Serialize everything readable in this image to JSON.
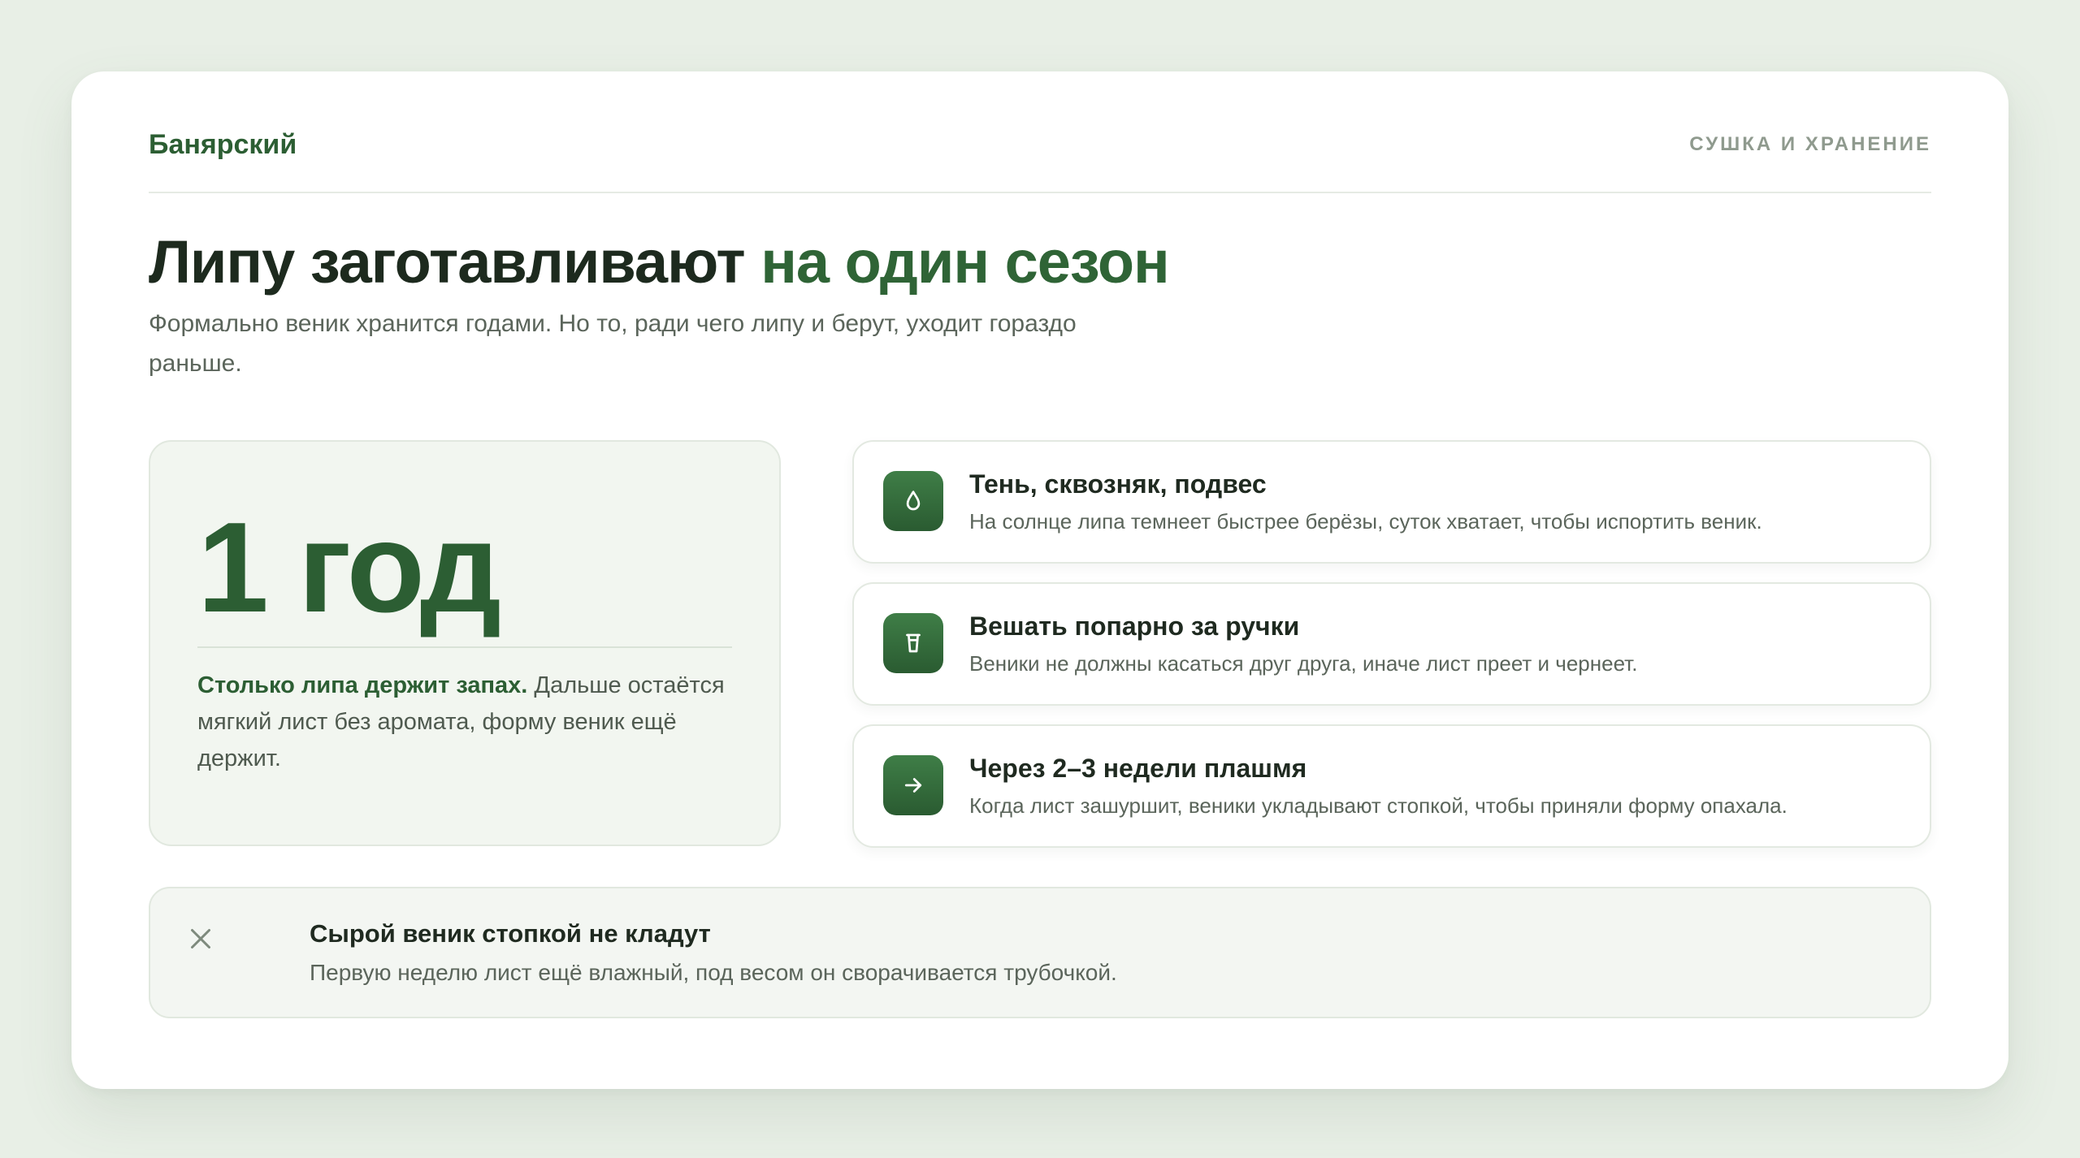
{
  "header": {
    "brand": "Банярский",
    "section": "СУШКА И ХРАНЕНИЕ"
  },
  "hero": {
    "title_main": "Липу заготавливают",
    "title_accent": "на один сезон",
    "subtitle": "Формально веник хранится годами. Но то, ради чего липу и берут, уходит гораздо раньше."
  },
  "stat": {
    "value": "1 год",
    "lead": "Столько липа держит запах.",
    "text": " Дальше остаётся мягкий лист без аромата, форму веник ещё держит."
  },
  "tips": [
    {
      "icon": "drop-icon",
      "title": "Тень, сквозняк, подвес",
      "text": "На солнце липа темнеет быстрее берёзы, суток хватает, чтобы испортить веник."
    },
    {
      "icon": "bucket-icon",
      "title": "Вешать попарно за ручки",
      "text": "Веники не должны касаться друг друга, иначе лист преет и чернеет."
    },
    {
      "icon": "arrow-right-icon",
      "title": "Через 2–3 недели плашмя",
      "text": "Когда лист зашуршит, веники укладывают стопкой, чтобы приняли форму опахала."
    }
  ],
  "warning": {
    "icon": "close-icon",
    "title": "Сырой веник стопкой не кладут",
    "text": "Первую неделю лист ещё влажный, под весом он сворачивается трубочкой."
  },
  "colors": {
    "accent": "#2f6436",
    "background": "#e8efe6",
    "card": "#ffffff",
    "muted": "#8f9a8e"
  }
}
